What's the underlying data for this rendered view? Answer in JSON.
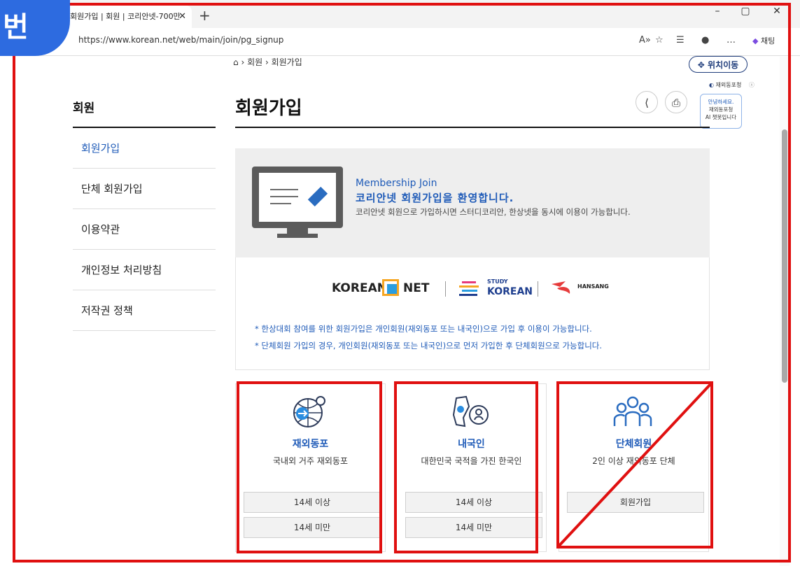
{
  "browser": {
    "tab_title": "회원가입 | 회원 | 코리안넷-700만",
    "url": "https://www.korean.net/web/main/join/pg_signup",
    "chat_label": "채팅"
  },
  "badge": "번",
  "breadcrumb": {
    "home": "⌂",
    "level1": "회원",
    "level2": "회원가입"
  },
  "move_button": "위치이동",
  "chatbot": {
    "label": "재외동포청",
    "line1": "안녕하세요.",
    "line2": "재외동포청",
    "line3": "AI 챗봇입니다"
  },
  "sidebar": {
    "title": "회원",
    "items": [
      {
        "label": "회원가입"
      },
      {
        "label": "단체 회원가입"
      },
      {
        "label": "이용약관"
      },
      {
        "label": "개인정보 처리방침"
      },
      {
        "label": "저작권 정책"
      }
    ]
  },
  "main": {
    "title": "회원가입",
    "welcome_en": "Membership Join",
    "welcome_ko": "코리안넷 회원가입을 환영합니다.",
    "welcome_desc": "코리안넷 회원으로 가입하시면 스터디코리안, 한상넷을 동시에 이용이 가능합니다.",
    "logos": {
      "korean": "KOREAN",
      "net": "NET",
      "study": "STUDY",
      "korean2": "KOREAN",
      "hansang": "HANSANG"
    },
    "notes": [
      "* 한상대회 참여를 위한 회원가입은 개인회원(재외동포 또는 내국인)으로 가입 후 이용이 가능합니다.",
      "* 단체회원 가입의 경우, 개인회원(재외동포 또는 내국인)으로 먼저 가입한 후 단체회원으로 가능합니다."
    ],
    "cards": [
      {
        "title": "재외동포",
        "desc": "국내외 거주 재외동포",
        "buttons": [
          "14세 이상",
          "14세 미만"
        ]
      },
      {
        "title": "내국인",
        "desc": "대한민국 국적을 가진 한국인",
        "buttons": [
          "14세 이상",
          "14세 미만"
        ]
      },
      {
        "title": "단체회원",
        "desc": "2인 이상 재외동포 단체",
        "buttons": [
          "회원가입"
        ]
      }
    ]
  },
  "colors": {
    "accent": "#1f5bb8",
    "highlight": "#e01010",
    "badge": "#2d6be0"
  }
}
